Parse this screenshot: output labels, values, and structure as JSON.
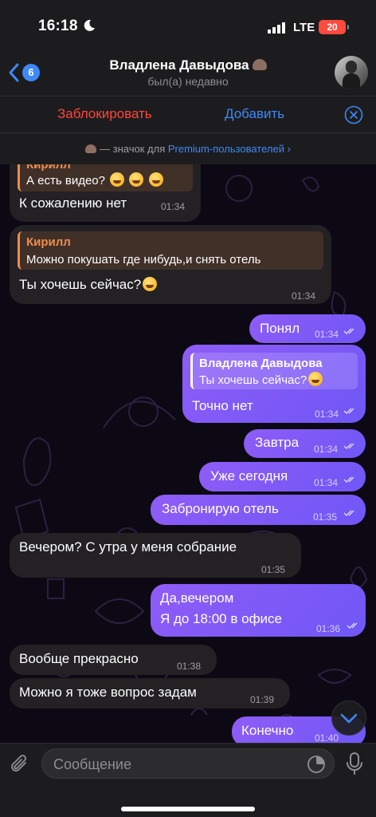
{
  "status_bar": {
    "time": "16:18",
    "network": "LTE",
    "battery": "20"
  },
  "header": {
    "unread_count": "6",
    "name": "Владлена Давыдова",
    "status": "был(а) недавно"
  },
  "action_bar": {
    "block_label": "Заблокировать",
    "add_label": "Добавить"
  },
  "premium_bar": {
    "prefix": "— значок для ",
    "link": "Premium-пользователей",
    "chevron": "›"
  },
  "messages": [
    {
      "quote_name": "Кирилл",
      "quote_text": "А есть видео?",
      "text": "К сожалению нет",
      "time": "01:34"
    },
    {
      "quote_name": "Кирилл",
      "quote_text": "Можно покушать где нибудь,и снять отель",
      "text": "Ты хочешь сейчас?",
      "time": "01:34"
    },
    {
      "text": "Понял",
      "time": "01:34"
    },
    {
      "quote_name": "Владлена Давыдова",
      "quote_text": "Ты хочешь сейчас?",
      "text": "Точно нет",
      "time": "01:34"
    },
    {
      "text": "Завтра",
      "time": "01:34"
    },
    {
      "text": "Уже сегодня",
      "time": "01:34"
    },
    {
      "text": "Забронирую отель",
      "time": "01:35"
    },
    {
      "text": "Вечером? С утра у меня собрание",
      "time": "01:35"
    },
    {
      "line1": "Да,вечером",
      "line2": "Я до 18:00 в офисе",
      "time": "01:36"
    },
    {
      "text": "Вообще прекрасно",
      "time": "01:38"
    },
    {
      "text": "Можно я тоже вопрос задам",
      "time": "01:39"
    },
    {
      "text": "Конечно",
      "time": "01:40"
    }
  ],
  "input": {
    "placeholder": "Сообщение"
  },
  "colors": {
    "accent": "#3e88f7",
    "danger": "#ff453a",
    "quote_in": "#ef8c4a",
    "bubble_out": "#8f5cf7",
    "bubble_in": "#232124"
  }
}
